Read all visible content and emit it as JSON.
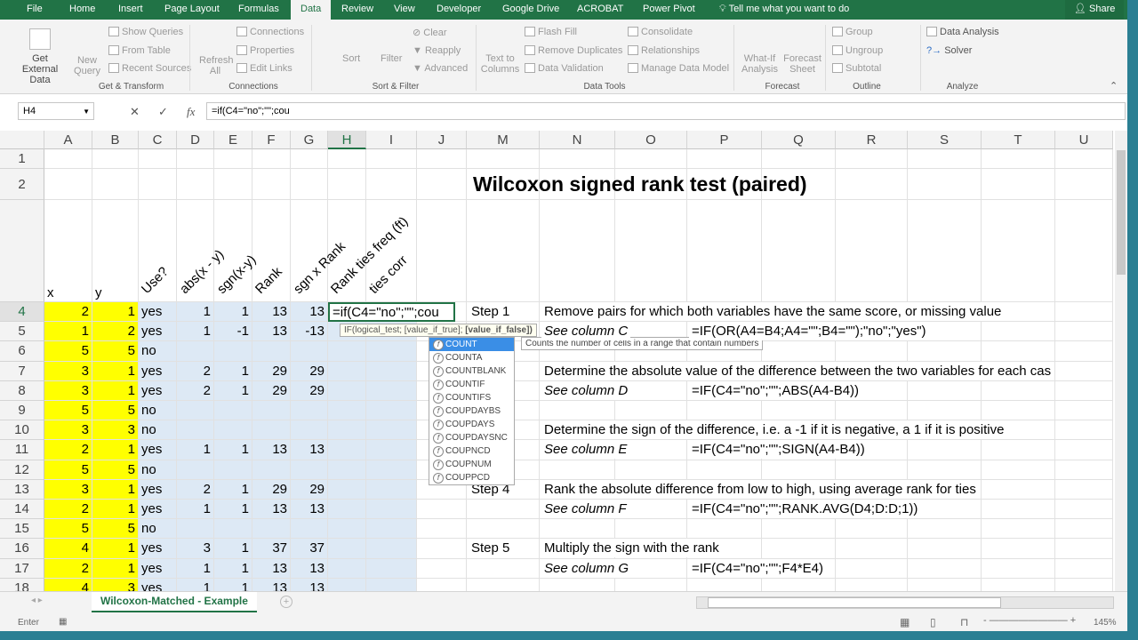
{
  "ribbon": {
    "tabs": [
      "File",
      "Home",
      "Insert",
      "Page Layout",
      "Formulas",
      "Data",
      "Review",
      "View",
      "Developer",
      "Google Drive",
      "ACROBAT",
      "Power Pivot"
    ],
    "tell_me": "Tell me what you want to do",
    "share": "Share",
    "get_external": "Get External Data",
    "new_query": "New Query",
    "show_queries": "Show Queries",
    "from_table": "From Table",
    "recent_sources": "Recent Sources",
    "group_get": "Get & Transform",
    "refresh": "Refresh All",
    "connections": "Connections",
    "properties": "Properties",
    "edit_links": "Edit Links",
    "group_conn": "Connections",
    "sort": "Sort",
    "filter": "Filter",
    "clear": "Clear",
    "reapply": "Reapply",
    "advanced": "Advanced",
    "group_sort": "Sort & Filter",
    "text_to_columns": "Text to Columns",
    "flash_fill": "Flash Fill",
    "remove_dup": "Remove Duplicates",
    "data_validation": "Data Validation",
    "consolidate": "Consolidate",
    "relationships": "Relationships",
    "manage_model": "Manage Data Model",
    "group_tools": "Data Tools",
    "what_if": "What-If Analysis",
    "forecast_sheet": "Forecast Sheet",
    "group_forecast": "Forecast",
    "group": "Group",
    "ungroup": "Ungroup",
    "subtotal": "Subtotal",
    "group_outline": "Outline",
    "data_analysis": "Data Analysis",
    "solver": "Solver",
    "group_analyze": "Analyze"
  },
  "formula_bar": {
    "name_box": "H4",
    "formula": "=if(C4=\"no\";\"\";cou"
  },
  "columns": [
    "A",
    "B",
    "C",
    "D",
    "E",
    "F",
    "G",
    "H",
    "I",
    "J",
    "M",
    "N",
    "O",
    "P",
    "Q",
    "R",
    "S",
    "T",
    "U"
  ],
  "title": "Wilcoxon signed rank test (paired)",
  "headers": {
    "x": "x",
    "y": "y",
    "rotated": [
      "Use?",
      "abs(x - y)",
      "sgn(x-y)",
      "Rank",
      "sgn x Rank",
      "Rank ties freq (ft)",
      "ties corr"
    ]
  },
  "rows": [
    [
      "2",
      "1",
      "yes",
      "1",
      "1",
      "13",
      "13"
    ],
    [
      "1",
      "2",
      "yes",
      "1",
      "-1",
      "13",
      "-13"
    ],
    [
      "5",
      "5",
      "no",
      "",
      "",
      "",
      ""
    ],
    [
      "3",
      "1",
      "yes",
      "2",
      "1",
      "29",
      "29"
    ],
    [
      "3",
      "1",
      "yes",
      "2",
      "1",
      "29",
      "29"
    ],
    [
      "5",
      "5",
      "no",
      "",
      "",
      "",
      ""
    ],
    [
      "3",
      "3",
      "no",
      "",
      "",
      "",
      ""
    ],
    [
      "2",
      "1",
      "yes",
      "1",
      "1",
      "13",
      "13"
    ],
    [
      "5",
      "5",
      "no",
      "",
      "",
      "",
      ""
    ],
    [
      "3",
      "1",
      "yes",
      "2",
      "1",
      "29",
      "29"
    ],
    [
      "2",
      "1",
      "yes",
      "1",
      "1",
      "13",
      "13"
    ],
    [
      "5",
      "5",
      "no",
      "",
      "",
      "",
      ""
    ],
    [
      "4",
      "1",
      "yes",
      "3",
      "1",
      "37",
      "37"
    ],
    [
      "2",
      "1",
      "yes",
      "1",
      "1",
      "13",
      "13"
    ],
    [
      "4",
      "3",
      "yes",
      "1",
      "1",
      "13",
      "13"
    ]
  ],
  "editing_cell": "=if(C4=\"no\";\"\";cou",
  "notes": [
    {
      "row": 4,
      "m": "Step 1",
      "n": "Remove pairs for which both variables have the same score, or missing value"
    },
    {
      "row": 5,
      "n": "See column C",
      "p": "=IF(OR(A4=B4;A4=\"\";B4=\"\");\"no\";\"yes\")",
      "italic": true
    },
    {
      "row": 7,
      "n": "Determine the absolute value of the difference between the two variables for each cas"
    },
    {
      "row": 8,
      "n": "See column D",
      "p": "=IF(C4=\"no\";\"\";ABS(A4-B4))",
      "italic": true
    },
    {
      "row": 10,
      "n": "Determine the sign of the difference, i.e. a -1 if it is negative, a 1 if it is positive"
    },
    {
      "row": 11,
      "n": "See column E",
      "p": "=IF(C4=\"no\";\"\";SIGN(A4-B4))",
      "italic": true
    },
    {
      "row": 13,
      "m": "Step 4",
      "n": "Rank the absolute difference from low to high, using average rank for ties"
    },
    {
      "row": 14,
      "n": "See column F",
      "p": "=IF(C4=\"no\";\"\";RANK.AVG(D4;D:D;1))",
      "italic": true
    },
    {
      "row": 16,
      "m": "Step 5",
      "n": "Multiply the sign with the rank"
    },
    {
      "row": 17,
      "n": "See column G",
      "p": "=IF(C4=\"no\";\"\";F4*E4)",
      "italic": true
    }
  ],
  "tooltip": {
    "text": "IF(logical_test; [value_if_true]; ",
    "bold": "[value_if_false])"
  },
  "autocomplete": {
    "items": [
      "COUNT",
      "COUNTA",
      "COUNTBLANK",
      "COUNTIF",
      "COUNTIFS",
      "COUPDAYBS",
      "COUPDAYS",
      "COUPDAYSNC",
      "COUPNCD",
      "COUPNUM",
      "COUPPCD"
    ],
    "description": "Counts the number of cells in a range that contain numbers"
  },
  "sheet_tab": "Wilcoxon-Matched - Example",
  "status": {
    "mode": "Enter",
    "zoom": "145%"
  },
  "colors": {
    "accent": "#217346",
    "highlight_yellow": "#ffff00",
    "highlight_blue": "#dde9f5"
  }
}
